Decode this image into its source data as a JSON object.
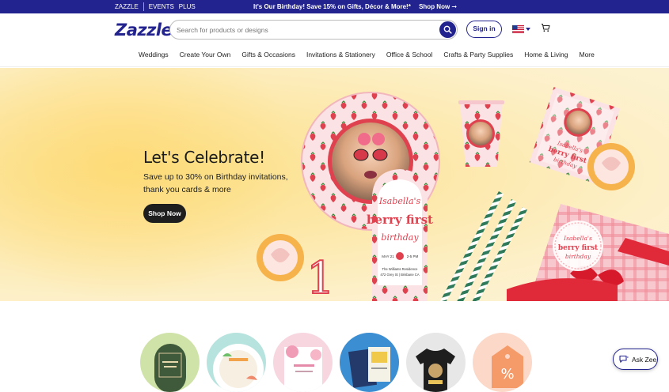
{
  "topbar": {
    "brand1": "ZAZZLE",
    "brand2": "EVENTS",
    "brand3": "PLUS",
    "promo": "It's Our Birthday! Save 15% on Gifts, Décor & More!*",
    "promo_link": "Shop Now ➞"
  },
  "header": {
    "logo": "Zazzle",
    "search_placeholder": "Search for products or designs",
    "signin": "Sign in",
    "icons": [
      "search-icon",
      "us-flag-icon",
      "cart-icon"
    ]
  },
  "nav": {
    "items": [
      "Weddings",
      "Create Your Own",
      "Gifts & Occasions",
      "Invitations & Stationery",
      "Office & School",
      "Crafts & Party Supplies",
      "Home & Living",
      "More"
    ]
  },
  "hero": {
    "title": "Let's Celebrate!",
    "subtitle": "Save up to 30% on Birthday invitations, thank you cards & more",
    "cta": "Shop Now",
    "invite_name": "Isabella's",
    "invite_title": "berry first",
    "invite_word": "birthday",
    "invite_date": "MAY 21",
    "invite_time": "2-5 PM",
    "invite_place": "The Williams Residence",
    "invite_address": "472 Grey St | Brisbane CA",
    "napkin_name": "Isabella's",
    "napkin_title": "berry first",
    "napkin_word": "birthday",
    "tag_name": "Isabella's",
    "tag_title": "berry first",
    "tag_word": "birthday",
    "candle_number": "1",
    "colors": {
      "accent": "#23238f",
      "hero_bg": "#fde7a6",
      "berry": "#e03a4a"
    }
  },
  "chat": {
    "label": "Ask Zee"
  }
}
